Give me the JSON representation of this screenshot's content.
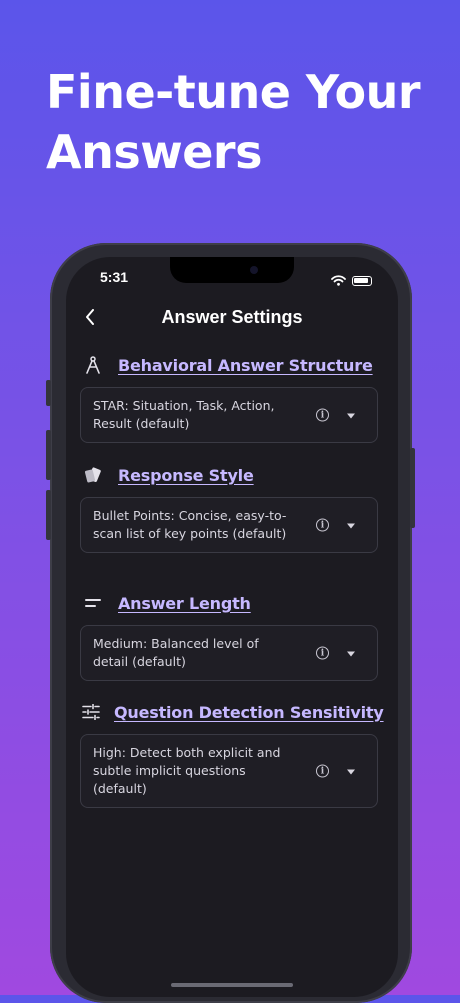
{
  "headline": {
    "line1": "Fine-tune Your",
    "line2": "Answers"
  },
  "status_bar": {
    "time": "5:31"
  },
  "nav": {
    "title": "Answer Settings"
  },
  "accent_color": "#c6b8ff",
  "sections": [
    {
      "icon": "compass-icon",
      "title": "Behavioral Answer Structure",
      "value": "STAR: Situation, Task, Action, Result (default)"
    },
    {
      "icon": "cards-icon",
      "title": "Response Style",
      "value": "Bullet Points: Concise, easy-to-scan list of key points (default)"
    },
    {
      "icon": "short-text-icon",
      "title": "Answer Length",
      "value": "Medium: Balanced level of detail (default)"
    },
    {
      "icon": "tune-icon",
      "title": "Question Detection Sensitivity",
      "value": "High: Detect both explicit and subtle implicit questions (default)"
    }
  ]
}
